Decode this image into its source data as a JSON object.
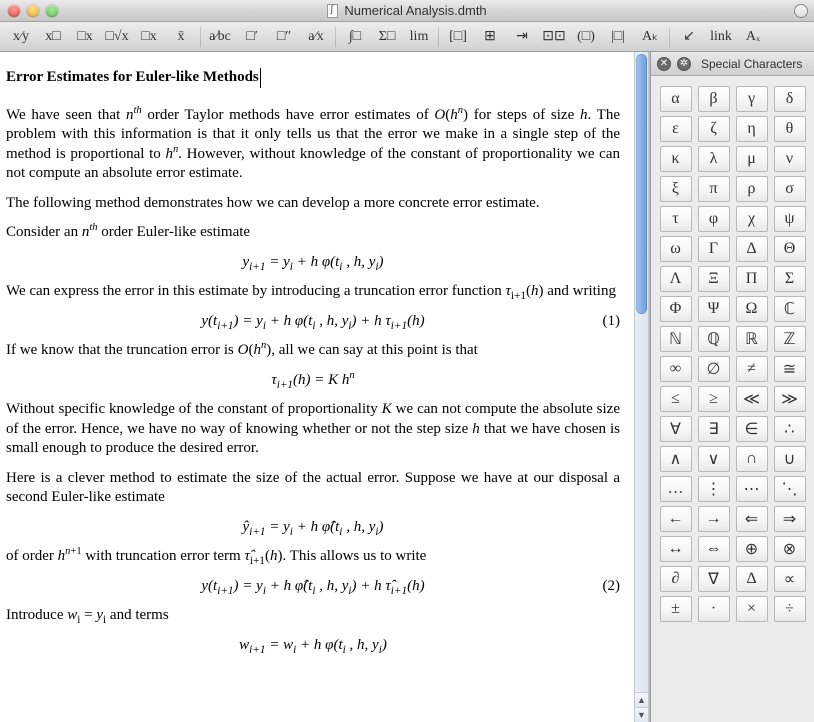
{
  "window": {
    "title": "Numerical Analysis.dmth"
  },
  "toolbar": {
    "buttons": [
      "x⁄y",
      "x□",
      "□x",
      "□√x",
      "□x",
      "x̄",
      "a⁄bc",
      "□′",
      "□″",
      "a⁄x",
      "∫□",
      "Σ□",
      "lim",
      "[□]",
      "⊞",
      "⇥",
      "⊡⊡",
      "(□)",
      "|□|",
      "Aₖ",
      "↙",
      "link",
      "Aₓ"
    ]
  },
  "document": {
    "heading": "Error Estimates for Euler-like Methods",
    "para1_a": "We have seen that ",
    "para1_b": " order Taylor methods have error estimates of ",
    "para1_c": " for steps of size ",
    "para1_d": ". The problem with this information is that it only tells us that the error we make in a single step of the method is proportional to ",
    "para1_e": ". However, without knowledge of the constant of proportionality we can not compute an absolute error estimate.",
    "para2": "The following method demonstrates how we can develop a more concrete error estimate.",
    "para3_a": "Consider an ",
    "para3_b": " order Euler-like estimate",
    "eq1": "yᵢ₊₁ = yᵢ + h φ(tᵢ , h, yᵢ)",
    "para4_a": "We can express the error in this estimate by introducing a truncation error function ",
    "para4_b": " and writing",
    "eq2": "y(tᵢ₊₁) = yᵢ + h φ(tᵢ , h, yᵢ) + h τᵢ₊₁(h)",
    "eq2_num": "(1)",
    "para5_a": "If we know that the truncation error is ",
    "para5_b": ", all we can say at this point is that",
    "eq3": "τᵢ₊₁(h) = K hⁿ",
    "para6_a": "Without specific knowledge of the constant of proportionality ",
    "para6_b": " we can not compute the absolute size of the error. Hence, we have no way of knowing whether or not the step size ",
    "para6_c": " that we have chosen is small enough to produce the desired error.",
    "para7": "Here is a clever method to estimate the size of the actual error. Suppose we have at our disposal a second Euler-like estimate",
    "eq4": "ŷᵢ₊₁ = yᵢ + h φ̂(tᵢ , h, yᵢ)",
    "para8_a": "of order ",
    "para8_b": " with truncation error term ",
    "para8_c": ". This allows us to write",
    "eq5": "y(tᵢ₊₁) = yᵢ + h φ̂(tᵢ , h, yᵢ) + h τ̂ᵢ₊₁(h)",
    "eq5_num": "(2)",
    "para9_a": "Introduce ",
    "para9_b": " and terms",
    "eq6": "wᵢ₊₁ = wᵢ + h φ(tᵢ , h, yᵢ)"
  },
  "sidepanel": {
    "title": "Special Characters",
    "chars": [
      "α",
      "β",
      "γ",
      "δ",
      "ε",
      "ζ",
      "η",
      "θ",
      "κ",
      "λ",
      "μ",
      "ν",
      "ξ",
      "π",
      "ρ",
      "σ",
      "τ",
      "φ",
      "χ",
      "ψ",
      "ω",
      "Γ",
      "Δ",
      "Θ",
      "Λ",
      "Ξ",
      "Π",
      "Σ",
      "Φ",
      "Ψ",
      "Ω",
      "ℂ",
      "ℕ",
      "ℚ",
      "ℝ",
      "ℤ",
      "∞",
      "∅",
      "≠",
      "≅",
      "≤",
      "≥",
      "≪",
      "≫",
      "∀",
      "∃",
      "∈",
      "∴",
      "∧",
      "∨",
      "∩",
      "∪",
      "…",
      "⋮",
      "⋯",
      "⋱",
      "←",
      "→",
      "⇐",
      "⇒",
      "↔",
      "⇔",
      "⊕",
      "⊗",
      "∂",
      "∇",
      "Δ",
      "∝",
      "±",
      "·",
      "×",
      "÷"
    ]
  }
}
